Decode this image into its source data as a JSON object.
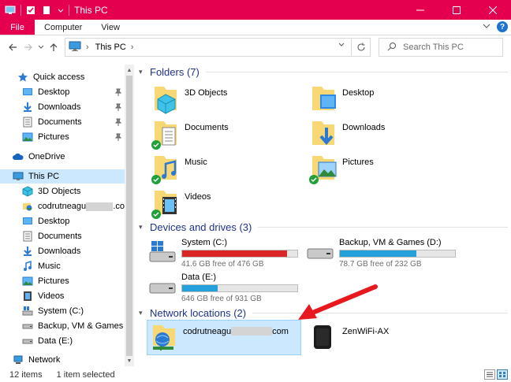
{
  "window": {
    "title": "This PC"
  },
  "ribbon": {
    "tabs": [
      "File",
      "Computer",
      "View"
    ]
  },
  "address": {
    "location": "This PC"
  },
  "search": {
    "placeholder": "Search This PC"
  },
  "sidebar": {
    "items": [
      {
        "label": "Quick access",
        "icon": "star-icon"
      },
      {
        "label": "Desktop",
        "icon": "desktop-folder-icon",
        "pinned": true
      },
      {
        "label": "Downloads",
        "icon": "download-arrow-icon",
        "pinned": true
      },
      {
        "label": "Documents",
        "icon": "documents-icon",
        "pinned": true
      },
      {
        "label": "Pictures",
        "icon": "pictures-icon",
        "pinned": true
      },
      {
        "label": "OneDrive",
        "icon": "cloud-icon"
      },
      {
        "label": "This PC",
        "icon": "monitor-icon",
        "selected": true
      },
      {
        "label": "3D Objects",
        "icon": "cube-icon"
      },
      {
        "label": "codrutneagu",
        "label_suffix": ".co",
        "icon": "network-folder-icon",
        "obscured": true
      },
      {
        "label": "Desktop",
        "icon": "desktop-folder-icon"
      },
      {
        "label": "Documents",
        "icon": "documents-icon"
      },
      {
        "label": "Downloads",
        "icon": "download-arrow-icon"
      },
      {
        "label": "Music",
        "icon": "music-note-icon"
      },
      {
        "label": "Pictures",
        "icon": "pictures-icon"
      },
      {
        "label": "Videos",
        "icon": "film-icon"
      },
      {
        "label": "System (C:)",
        "icon": "windows-drive-icon"
      },
      {
        "label": "Backup, VM & Games (D:)",
        "icon": "drive-icon"
      },
      {
        "label": "Data (E:)",
        "icon": "drive-icon"
      },
      {
        "label": "Network",
        "icon": "network-icon"
      }
    ]
  },
  "groups": {
    "folders": {
      "title": "Folders (7)"
    },
    "drives": {
      "title": "Devices and drives (3)"
    },
    "network": {
      "title": "Network locations (2)"
    }
  },
  "folders": [
    {
      "label": "3D Objects",
      "icon": "cube-icon",
      "synced": false
    },
    {
      "label": "Desktop",
      "icon": "desktop-folder-icon",
      "synced": false
    },
    {
      "label": "Documents",
      "icon": "documents-icon",
      "synced": true
    },
    {
      "label": "Downloads",
      "icon": "download-arrow-icon",
      "synced": false
    },
    {
      "label": "Music",
      "icon": "music-note-icon",
      "synced": true
    },
    {
      "label": "Pictures",
      "icon": "pictures-icon",
      "synced": true
    },
    {
      "label": "Videos",
      "icon": "film-icon",
      "synced": true
    }
  ],
  "drives": [
    {
      "name": "System (C:)",
      "free_text": "41.6 GB free of 476 GB",
      "used_fraction": 0.913,
      "bar_color": "#da2626",
      "icon": "windows-drive-icon"
    },
    {
      "name": "Backup, VM & Games (D:)",
      "free_text": "78.7 GB free of 232 GB",
      "used_fraction": 0.661,
      "bar_color": "#26a0da",
      "icon": "drive-icon"
    },
    {
      "name": "Data (E:)",
      "free_text": "646 GB free of 931 GB",
      "used_fraction": 0.306,
      "bar_color": "#26a0da",
      "icon": "drive-icon"
    }
  ],
  "network_locations": [
    {
      "label": "codrutneagu",
      "label_suffix": "com",
      "obscured": true,
      "selected": true,
      "icon": "network-folder-icon"
    },
    {
      "label": "ZenWiFi-AX",
      "icon": "router-icon"
    }
  ],
  "status": {
    "item_count": "12 items",
    "selected": "1 item selected"
  },
  "colors": {
    "accent": "#e5004f",
    "selection": "#cce8ff",
    "group_title": "#1e3287",
    "drive_full": "#da2626",
    "drive_normal": "#26a0da",
    "arrow": "#e8191e"
  }
}
